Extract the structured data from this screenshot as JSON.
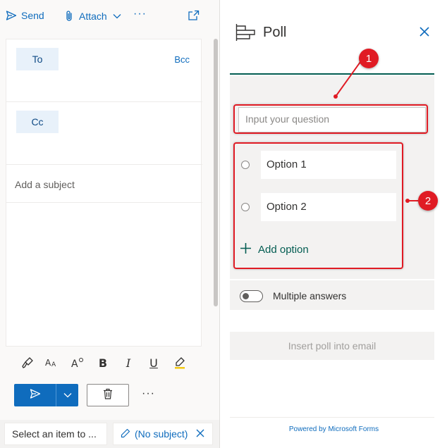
{
  "colors": {
    "accent_blue": "#0f6cbd",
    "forms_teal": "#035d52",
    "annotation_red": "#e01b24",
    "panel_gray": "#f3f2f1"
  },
  "toolbar": {
    "send_label": "Send",
    "send_icon": "paper-plane-icon",
    "attach_label": "Attach",
    "attach_icon": "paperclip-icon",
    "more_label": "···",
    "popout_icon": "popout-icon"
  },
  "compose": {
    "to_label": "To",
    "bcc_label": "Bcc",
    "cc_label": "Cc",
    "subject_placeholder": "Add a subject"
  },
  "format_bar": {
    "icons": [
      "format-painter-icon",
      "font-size-icon",
      "text-effects-icon",
      "bold-icon",
      "italic-icon",
      "underline-icon",
      "highlight-icon"
    ],
    "bold_glyph": "B",
    "italic_glyph": "I",
    "underline_glyph": "U"
  },
  "actions": {
    "send_icon": "send-icon",
    "dropdown_icon": "chevron-down-icon",
    "discard_icon": "trash-icon",
    "more_label": "···"
  },
  "tabs": [
    {
      "label": "Select an item to ..."
    },
    {
      "label": "(No subject)"
    }
  ],
  "poll": {
    "title": "Poll",
    "question_placeholder": "Input your question",
    "options": [
      {
        "label": "Option 1"
      },
      {
        "label": "Option 2"
      }
    ],
    "add_option_label": "Add option",
    "multiple_answers_label": "Multiple answers",
    "multiple_answers_on": false,
    "insert_label": "Insert poll into email",
    "powered_by": "Powered by Microsoft Forms"
  },
  "annotations": [
    {
      "number": "1"
    },
    {
      "number": "2"
    }
  ]
}
